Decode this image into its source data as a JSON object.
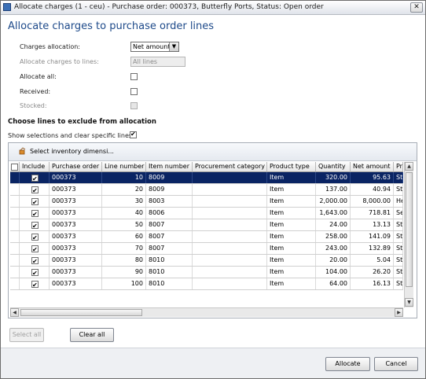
{
  "window": {
    "title": "Allocate charges (1 - ceu) - Purchase order: 000373, Butterfly Ports, Status: Open order",
    "close_glyph": "✕",
    "icon": "form-window-icon"
  },
  "heading": "Allocate charges to purchase order lines",
  "form": {
    "charges_allocation_label": "Charges allocation:",
    "charges_allocation_value": "Net amount",
    "allocate_to_lines_label": "Allocate charges to lines:",
    "allocate_to_lines_value": "All lines",
    "allocate_all_label": "Allocate all:",
    "received_label": "Received:",
    "stocked_label": "Stocked:"
  },
  "exclude_section": {
    "title": "Choose lines to exclude from allocation",
    "show_selections_label": "Show selections and clear specific lines:",
    "toolbar_button": "Select inventory dimensi..."
  },
  "grid": {
    "columns": [
      "Include",
      "Purchase order",
      "Line number",
      "Item number",
      "Procurement category",
      "Product type",
      "Quantity",
      "Net amount",
      "Pr"
    ],
    "rows": [
      {
        "order": "000373",
        "line": "10",
        "item": "8009",
        "category": "",
        "type": "Item",
        "qty": "320.00",
        "net": "95.63",
        "pr": "St"
      },
      {
        "order": "000373",
        "line": "20",
        "item": "8009",
        "category": "",
        "type": "Item",
        "qty": "137.00",
        "net": "40.94",
        "pr": "St"
      },
      {
        "order": "000373",
        "line": "30",
        "item": "8003",
        "category": "",
        "type": "Item",
        "qty": "2,000.00",
        "net": "8,000.00",
        "pr": "He"
      },
      {
        "order": "000373",
        "line": "40",
        "item": "8006",
        "category": "",
        "type": "Item",
        "qty": "1,643.00",
        "net": "718.81",
        "pr": "Se"
      },
      {
        "order": "000373",
        "line": "50",
        "item": "8007",
        "category": "",
        "type": "Item",
        "qty": "24.00",
        "net": "13.13",
        "pr": "St"
      },
      {
        "order": "000373",
        "line": "60",
        "item": "8007",
        "category": "",
        "type": "Item",
        "qty": "258.00",
        "net": "141.09",
        "pr": "St"
      },
      {
        "order": "000373",
        "line": "70",
        "item": "8007",
        "category": "",
        "type": "Item",
        "qty": "243.00",
        "net": "132.89",
        "pr": "St"
      },
      {
        "order": "000373",
        "line": "80",
        "item": "8010",
        "category": "",
        "type": "Item",
        "qty": "20.00",
        "net": "5.04",
        "pr": "St"
      },
      {
        "order": "000373",
        "line": "90",
        "item": "8010",
        "category": "",
        "type": "Item",
        "qty": "104.00",
        "net": "26.20",
        "pr": "St"
      },
      {
        "order": "000373",
        "line": "100",
        "item": "8010",
        "category": "",
        "type": "Item",
        "qty": "64.00",
        "net": "16.13",
        "pr": "St"
      }
    ]
  },
  "buttons": {
    "select_all": "Select all",
    "clear_all": "Clear all",
    "allocate": "Allocate",
    "cancel": "Cancel"
  },
  "colors": {
    "heading": "#1e4a8a",
    "selected_row": "#0a2463"
  }
}
